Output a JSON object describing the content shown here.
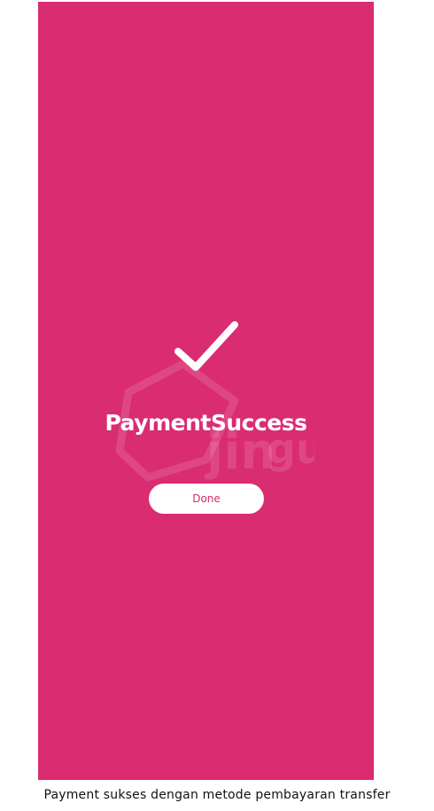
{
  "screen": {
    "background_color": "#da2c71",
    "status_icon": "checkmark-icon",
    "watermark_logo": "jingu",
    "title": "PaymentSuccess",
    "done_button_label": "Done"
  },
  "caption": "Payment sukses dengan metode pembayaran transfer"
}
